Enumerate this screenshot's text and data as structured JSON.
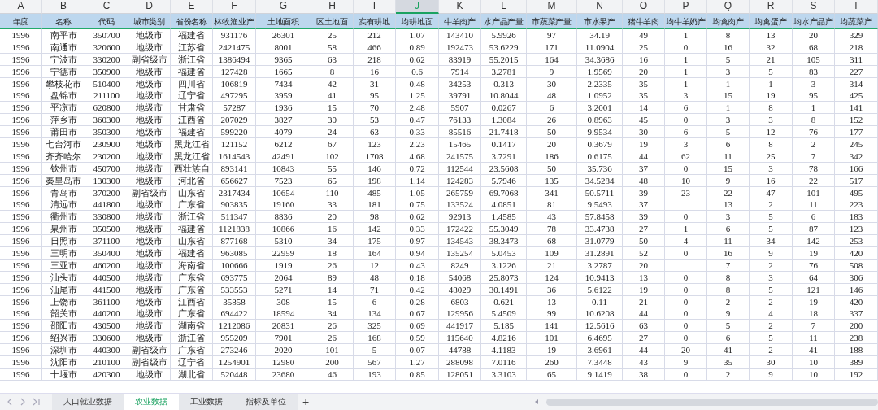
{
  "columns": [
    {
      "letter": "A",
      "header": "年度",
      "selected": false
    },
    {
      "letter": "B",
      "header": "名称",
      "selected": false
    },
    {
      "letter": "C",
      "header": "代码",
      "selected": false
    },
    {
      "letter": "D",
      "header": "城市类别",
      "selected": false
    },
    {
      "letter": "E",
      "header": "省份名称",
      "selected": false
    },
    {
      "letter": "F",
      "header": "林牧渔业产",
      "selected": false
    },
    {
      "letter": "G",
      "header": "土地面积",
      "selected": false
    },
    {
      "letter": "H",
      "header": "区土地面",
      "selected": false
    },
    {
      "letter": "I",
      "header": "实有耕地",
      "selected": false
    },
    {
      "letter": "J",
      "header": "均耕地面",
      "selected": true
    },
    {
      "letter": "K",
      "header": "牛羊肉产",
      "selected": false
    },
    {
      "letter": "L",
      "header": "水产品产量",
      "selected": false
    },
    {
      "letter": "M",
      "header": "市蔬菜产量",
      "selected": false
    },
    {
      "letter": "N",
      "header": "市水果产",
      "selected": false
    },
    {
      "letter": "O",
      "header": "猪牛羊肉",
      "selected": false
    },
    {
      "letter": "P",
      "header": "均牛羊奶产",
      "selected": false
    },
    {
      "letter": "Q",
      "header": "均禽肉产",
      "selected": false
    },
    {
      "letter": "R",
      "header": "均禽蛋产",
      "selected": false
    },
    {
      "letter": "S",
      "header": "均水产品产",
      "selected": false
    },
    {
      "letter": "T",
      "header": "均蔬菜产",
      "selected": false
    }
  ],
  "rows": [
    [
      "1996",
      "南平市",
      "350700",
      "地级市",
      "福建省",
      "931176",
      "26301",
      "25",
      "212",
      "1.07",
      "143410",
      "5.9926",
      "97",
      "34.19",
      "49",
      "1",
      "8",
      "13",
      "20",
      "329"
    ],
    [
      "1996",
      "南通市",
      "320600",
      "地级市",
      "江苏省",
      "2421475",
      "8001",
      "58",
      "466",
      "0.89",
      "192473",
      "53.6229",
      "171",
      "11.0904",
      "25",
      "0",
      "16",
      "32",
      "68",
      "218"
    ],
    [
      "1996",
      "宁波市",
      "330200",
      "副省级市",
      "浙江省",
      "1386494",
      "9365",
      "63",
      "218",
      "0.62",
      "83919",
      "55.2015",
      "164",
      "34.3686",
      "16",
      "1",
      "5",
      "21",
      "105",
      "311"
    ],
    [
      "1996",
      "宁德市",
      "350900",
      "地级市",
      "福建省",
      "127428",
      "1665",
      "8",
      "16",
      "0.6",
      "7914",
      "3.2781",
      "9",
      "1.9569",
      "20",
      "1",
      "3",
      "5",
      "83",
      "227"
    ],
    [
      "1996",
      "攀枝花市",
      "510400",
      "地级市",
      "四川省",
      "106819",
      "7434",
      "42",
      "31",
      "0.48",
      "34253",
      "0.313",
      "30",
      "2.2335",
      "35",
      "1",
      "1",
      "1",
      "3",
      "314"
    ],
    [
      "1996",
      "盘锦市",
      "211100",
      "地级市",
      "辽宁省",
      "497295",
      "3959",
      "41",
      "95",
      "1.25",
      "39791",
      "10.8044",
      "48",
      "1.0952",
      "35",
      "3",
      "15",
      "19",
      "95",
      "425"
    ],
    [
      "1996",
      "平凉市",
      "620800",
      "地级市",
      "甘肃省",
      "57287",
      "1936",
      "15",
      "70",
      "2.48",
      "5907",
      "0.0267",
      "6",
      "3.2001",
      "14",
      "6",
      "1",
      "8",
      "1",
      "141"
    ],
    [
      "1996",
      "萍乡市",
      "360300",
      "地级市",
      "江西省",
      "207029",
      "3827",
      "30",
      "53",
      "0.47",
      "76133",
      "1.3084",
      "26",
      "0.8963",
      "45",
      "0",
      "3",
      "3",
      "8",
      "152"
    ],
    [
      "1996",
      "莆田市",
      "350300",
      "地级市",
      "福建省",
      "599220",
      "4079",
      "24",
      "63",
      "0.33",
      "85516",
      "21.7418",
      "50",
      "9.9534",
      "30",
      "6",
      "5",
      "12",
      "76",
      "177"
    ],
    [
      "1996",
      "七台河市",
      "230900",
      "地级市",
      "黑龙江省",
      "121152",
      "6212",
      "67",
      "123",
      "2.23",
      "15465",
      "0.1417",
      "20",
      "0.3679",
      "19",
      "3",
      "6",
      "8",
      "2",
      "245"
    ],
    [
      "1996",
      "齐齐哈尔",
      "230200",
      "地级市",
      "黑龙江省",
      "1614543",
      "42491",
      "102",
      "1708",
      "4.68",
      "241575",
      "3.7291",
      "186",
      "0.6175",
      "44",
      "62",
      "11",
      "25",
      "7",
      "342"
    ],
    [
      "1996",
      "钦州市",
      "450700",
      "地级市",
      "西壮族自",
      "893141",
      "10843",
      "55",
      "146",
      "0.72",
      "112544",
      "23.5608",
      "50",
      "35.736",
      "37",
      "0",
      "15",
      "3",
      "78",
      "166"
    ],
    [
      "1996",
      "秦皇岛市",
      "130300",
      "地级市",
      "河北省",
      "656627",
      "7523",
      "65",
      "198",
      "1.14",
      "124283",
      "5.7946",
      "135",
      "34.5284",
      "48",
      "10",
      "9",
      "16",
      "22",
      "517"
    ],
    [
      "1996",
      "青岛市",
      "370200",
      "副省级市",
      "山东省",
      "2317434",
      "10654",
      "110",
      "485",
      "1.05",
      "265759",
      "69.7068",
      "341",
      "50.5711",
      "39",
      "23",
      "22",
      "47",
      "101",
      "495"
    ],
    [
      "1996",
      "清远市",
      "441800",
      "地级市",
      "广东省",
      "903835",
      "19160",
      "33",
      "181",
      "0.75",
      "133524",
      "4.0851",
      "81",
      "9.5493",
      "37",
      null,
      "13",
      "2",
      "11",
      "223"
    ],
    [
      "1996",
      "衢州市",
      "330800",
      "地级市",
      "浙江省",
      "511347",
      "8836",
      "20",
      "98",
      "0.62",
      "92913",
      "1.4585",
      "43",
      "57.8458",
      "39",
      "0",
      "3",
      "5",
      "6",
      "183"
    ],
    [
      "1996",
      "泉州市",
      "350500",
      "地级市",
      "福建省",
      "1121838",
      "10866",
      "16",
      "142",
      "0.33",
      "172422",
      "55.3049",
      "78",
      "33.4738",
      "27",
      "1",
      "6",
      "5",
      "87",
      "123"
    ],
    [
      "1996",
      "日照市",
      "371100",
      "地级市",
      "山东省",
      "877168",
      "5310",
      "34",
      "175",
      "0.97",
      "134543",
      "38.3473",
      "68",
      "31.0779",
      "50",
      "4",
      "11",
      "34",
      "142",
      "253"
    ],
    [
      "1996",
      "三明市",
      "350400",
      "地级市",
      "福建省",
      "963085",
      "22959",
      "18",
      "164",
      "0.94",
      "135254",
      "5.0453",
      "109",
      "31.2891",
      "52",
      "0",
      "16",
      "9",
      "19",
      "420"
    ],
    [
      "1996",
      "三亚市",
      "460200",
      "地级市",
      "海南省",
      "100666",
      "1919",
      "26",
      "12",
      "0.43",
      "8249",
      "3.1226",
      "21",
      "3.2787",
      "20",
      null,
      "7",
      "2",
      "76",
      "508"
    ],
    [
      "1996",
      "汕头市",
      "440500",
      "地级市",
      "广东省",
      "693775",
      "2064",
      "89",
      "48",
      "0.18",
      "54068",
      "25.8073",
      "124",
      "10.9413",
      "13",
      "0",
      "8",
      "3",
      "64",
      "306"
    ],
    [
      "1996",
      "汕尾市",
      "441500",
      "地级市",
      "广东省",
      "533553",
      "5271",
      "14",
      "71",
      "0.42",
      "48029",
      "30.1491",
      "36",
      "5.6122",
      "19",
      "0",
      "8",
      "5",
      "121",
      "146"
    ],
    [
      "1996",
      "上饶市",
      "361100",
      "地级市",
      "江西省",
      "35858",
      "308",
      "15",
      "6",
      "0.28",
      "6803",
      "0.621",
      "13",
      "0.11",
      "21",
      "0",
      "2",
      "2",
      "19",
      "420"
    ],
    [
      "1996",
      "韶关市",
      "440200",
      "地级市",
      "广东省",
      "694422",
      "18594",
      "34",
      "134",
      "0.67",
      "129956",
      "5.4509",
      "99",
      "10.6208",
      "44",
      "0",
      "9",
      "4",
      "18",
      "337"
    ],
    [
      "1996",
      "邵阳市",
      "430500",
      "地级市",
      "湖南省",
      "1212086",
      "20831",
      "26",
      "325",
      "0.69",
      "441917",
      "5.185",
      "141",
      "12.5616",
      "63",
      "0",
      "5",
      "2",
      "7",
      "200"
    ],
    [
      "1996",
      "绍兴市",
      "330600",
      "地级市",
      "浙江省",
      "955209",
      "7901",
      "26",
      "168",
      "0.59",
      "115640",
      "4.8216",
      "101",
      "6.4695",
      "27",
      "0",
      "6",
      "5",
      "11",
      "238"
    ],
    [
      "1996",
      "深圳市",
      "440300",
      "副省级市",
      "广东省",
      "273246",
      "2020",
      "101",
      "5",
      "0.07",
      "44788",
      "4.1183",
      "19",
      "3.6961",
      "44",
      "20",
      "41",
      "2",
      "41",
      "188"
    ],
    [
      "1996",
      "沈阳市",
      "210100",
      "副省级市",
      "辽宁省",
      "1254901",
      "12980",
      "200",
      "567",
      "1.27",
      "288098",
      "7.0116",
      "260",
      "7.3448",
      "43",
      "9",
      "35",
      "30",
      "10",
      "389"
    ],
    [
      "1996",
      "十堰市",
      "420300",
      "地级市",
      "湖北省",
      "520448",
      "23680",
      "46",
      "193",
      "0.85",
      "128051",
      "3.3103",
      "65",
      "9.1419",
      "38",
      "0",
      "2",
      "9",
      "10",
      "192"
    ]
  ],
  "sheet_tabs": [
    {
      "label": "人口就业数据",
      "selected": false
    },
    {
      "label": "农业数据",
      "selected": true
    },
    {
      "label": "工业数据",
      "selected": false
    },
    {
      "label": "指标及单位",
      "selected": false
    }
  ],
  "add_sheet": "+"
}
